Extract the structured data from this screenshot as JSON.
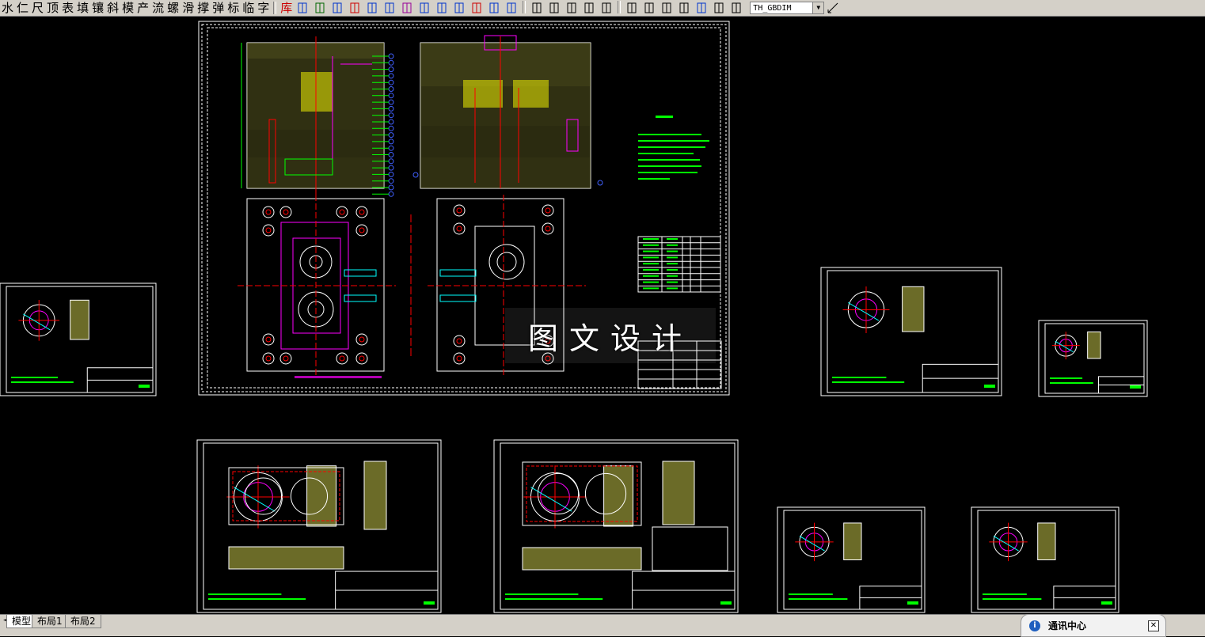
{
  "toolbar": {
    "commands": [
      "水",
      "仁",
      "尺",
      "顶",
      "表",
      "填",
      "镶",
      "斜",
      "模",
      "产",
      "流",
      "螺",
      "滑",
      "撑",
      "弹",
      "标",
      "临",
      "字"
    ],
    "library_label": "库",
    "dim_style": "TH_GBDIM"
  },
  "watermark": {
    "text": "图文设计"
  },
  "tabs": {
    "items": [
      "模型",
      "布局1",
      "布局2"
    ],
    "active": "模型"
  },
  "comm_center": {
    "title": "通讯中心"
  },
  "colors": {
    "canvas": "#000000",
    "sheet_border": "#ffffff",
    "green": "#00ff00",
    "yellow": "#ffff00",
    "red": "#ff0000",
    "magenta": "#ff00ff",
    "cyan": "#00ffff",
    "blue": "#4060ff"
  }
}
